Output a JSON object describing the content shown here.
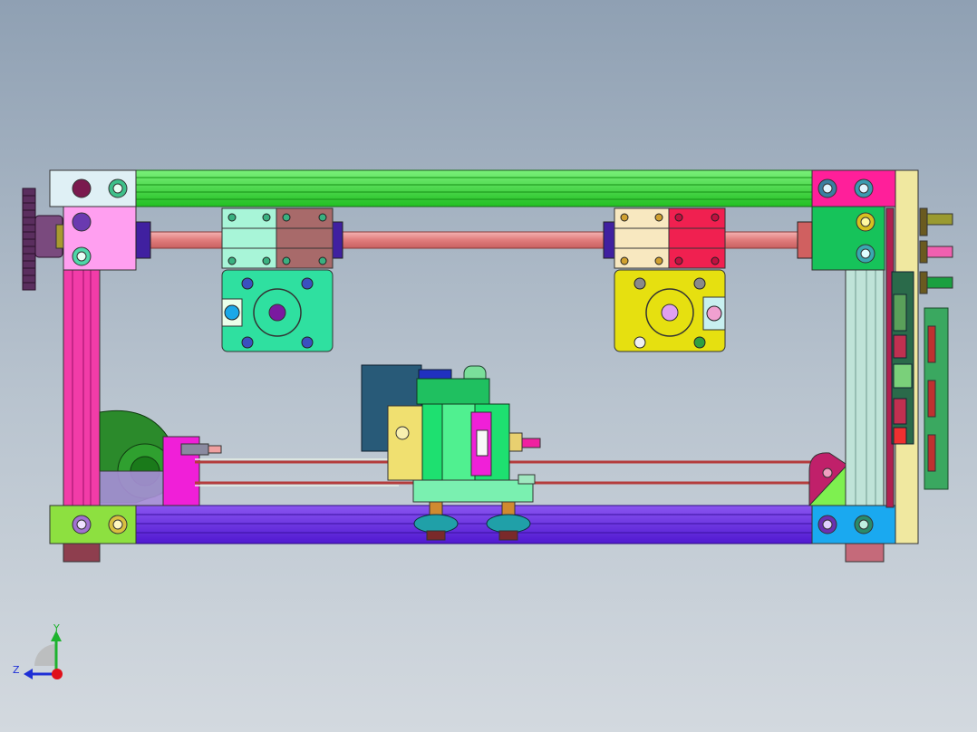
{
  "view": {
    "background_top": "#8fa0b3",
    "background_bottom": "#d3d9df"
  },
  "triad": {
    "y_label": "Y",
    "z_label": "Z",
    "y_color": "#1db32e",
    "z_color": "#1e2fd6",
    "x_color": "#e0101a"
  },
  "colors": {
    "top_rail": "#2ede2e",
    "bottom_rail": "#6a25e6",
    "left_post": "#f23ca8",
    "right_post": "#bfe3d8",
    "lead_screw": "#e88e8e",
    "carriage_left": "#2fe0a0",
    "carriage_right": "#e6e010",
    "block_top_left_pink": "#ff9ff0",
    "corner_right_magenta": "#ff1f9a",
    "corner_right_green": "#16c35a",
    "corner_bottom_left": "#8de040",
    "corner_bottom_right": "#1aa9f0",
    "handwheel": "#6a3e6e",
    "motor_green": "#1ee070",
    "motor_blue_pcb": "#285a78",
    "belt": "#b43c3c",
    "fan_green": "#2b8a2b",
    "side_panel": "#f0e8a0",
    "side_pcb": "#3aa860"
  }
}
